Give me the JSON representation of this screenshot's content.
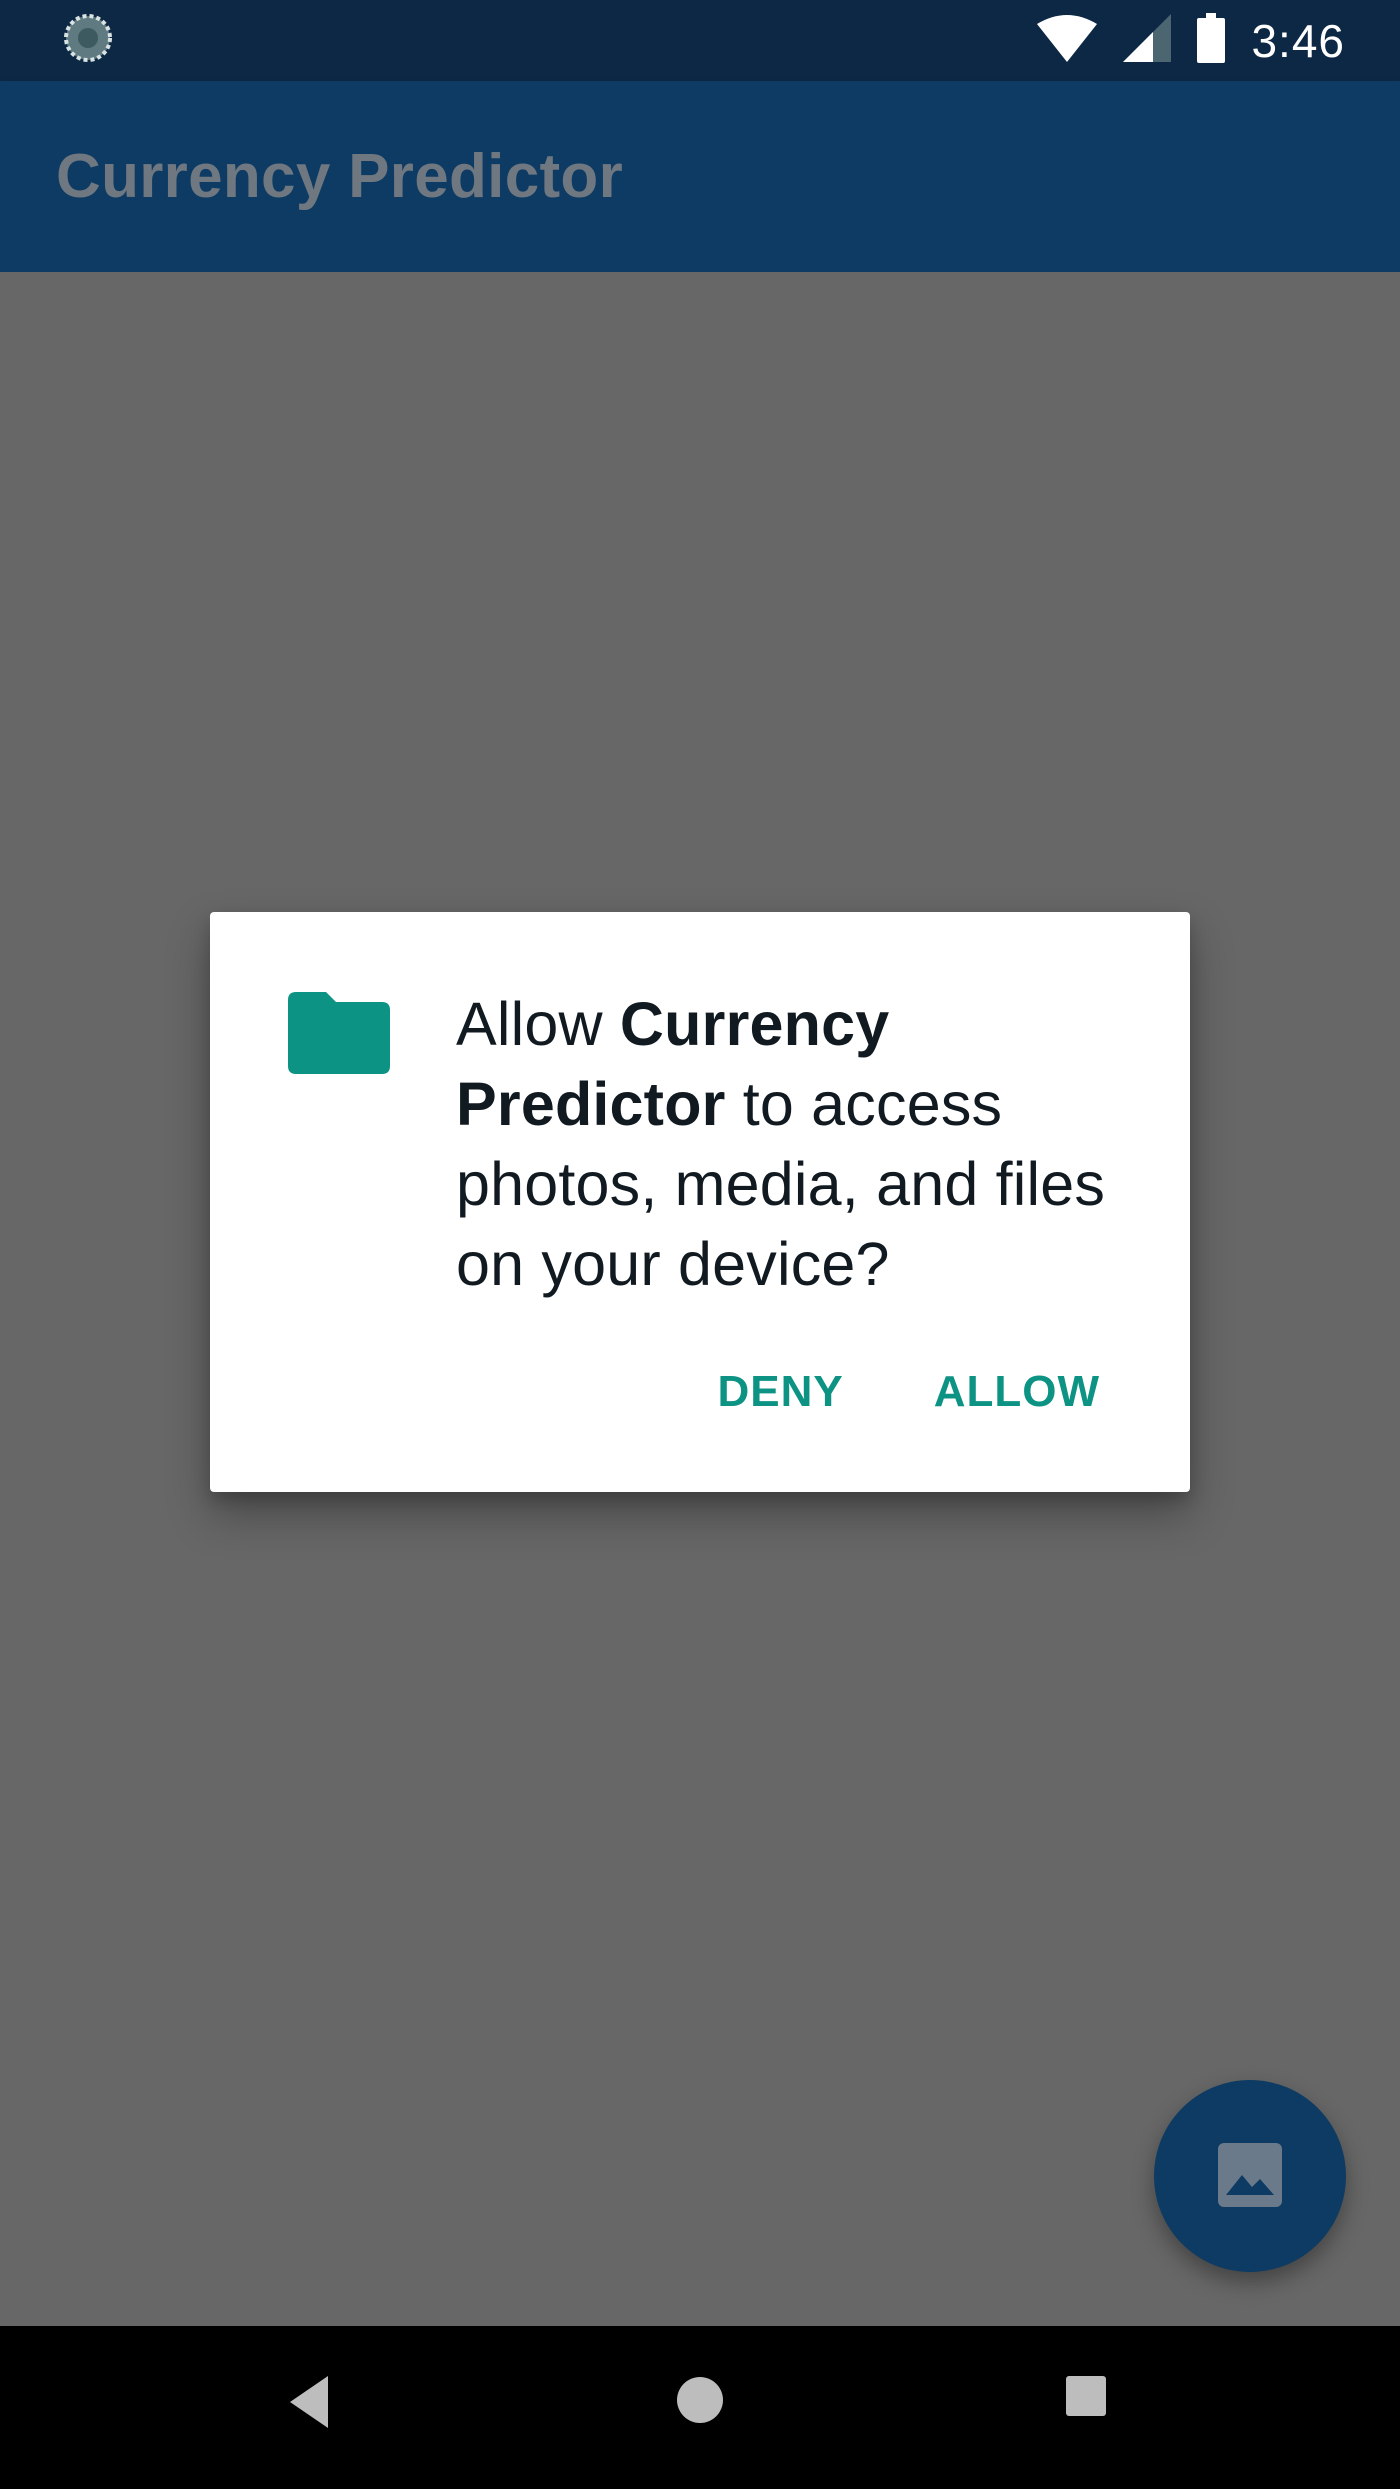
{
  "status_bar": {
    "time": "3:46",
    "icons": [
      "app-sync-icon",
      "wifi-icon",
      "cell-signal-icon",
      "battery-icon"
    ]
  },
  "app_bar": {
    "title": "Currency Predictor"
  },
  "dialog": {
    "icon": "folder-icon",
    "message_prefix": "Allow ",
    "app_name": "Currency Predictor",
    "message_suffix": " to access photos, media, and files on your device?",
    "deny_label": "DENY",
    "allow_label": "ALLOW"
  },
  "fab": {
    "icon": "image-icon"
  },
  "nav_bar": {
    "icons": [
      "back-icon",
      "home-icon",
      "recents-icon"
    ]
  },
  "colors": {
    "status_bar": "#0d2845",
    "app_bar": "#0d3b63",
    "scrim": "#676767",
    "accent": "#0d9384",
    "dialog_text": "#121a21"
  }
}
